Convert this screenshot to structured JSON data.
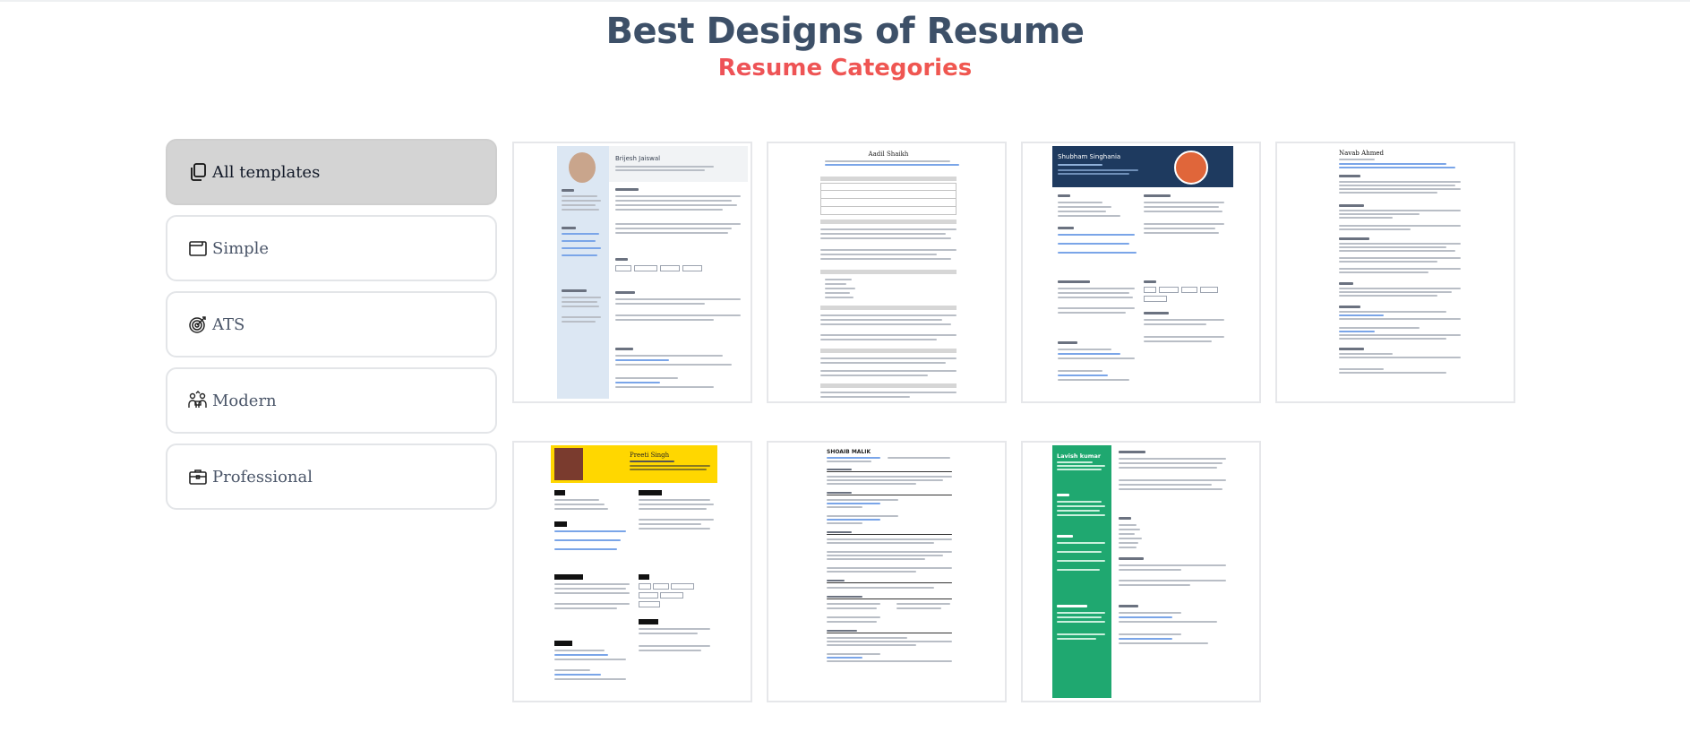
{
  "page": {
    "title": "Best Designs of Resume",
    "subtitle": "Resume Categories"
  },
  "categories": [
    {
      "label": "All templates",
      "icon": "copy-icon",
      "active": true
    },
    {
      "label": "Simple",
      "icon": "window-icon",
      "active": false
    },
    {
      "label": "ATS",
      "icon": "target-icon",
      "active": false
    },
    {
      "label": "Modern",
      "icon": "team-icon",
      "active": false
    },
    {
      "label": "Professional",
      "icon": "briefcase-icon",
      "active": false
    }
  ],
  "templates": [
    {
      "name": "Brijesh Jaiswal",
      "style": "photo-sidebar"
    },
    {
      "name": "Aadil Shaikh",
      "style": "ats-table"
    },
    {
      "name": "Shubham Singhania",
      "style": "dark-header"
    },
    {
      "name": "Navab Ahmed",
      "style": "plain-text"
    },
    {
      "name": "Preeti Singh",
      "style": "yellow-header"
    },
    {
      "name": "SHOAIB MALIK",
      "style": "minimal-lines"
    },
    {
      "name": "Lavish kumar",
      "style": "green-sidebar"
    }
  ],
  "colors": {
    "title": "#3d5068",
    "subtitle_gradient_start": "#e8456f",
    "subtitle_gradient_end": "#f4703a",
    "active_category_bg": "#d4d4d4",
    "dark_header": "#1e3a5f",
    "yellow_header": "#ffd700",
    "green_sidebar": "#1fa870"
  }
}
